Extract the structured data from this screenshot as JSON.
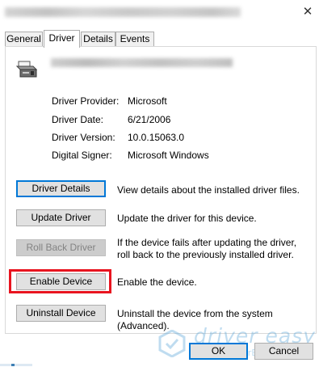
{
  "window": {
    "title_redacted": true,
    "close_glyph": "✕"
  },
  "tabs": [
    {
      "label": "General",
      "active": false
    },
    {
      "label": "Driver",
      "active": true
    },
    {
      "label": "Details",
      "active": false
    },
    {
      "label": "Events",
      "active": false
    }
  ],
  "device": {
    "icon": "printer-icon",
    "name_redacted": true
  },
  "properties": {
    "provider_label": "Driver Provider:",
    "provider_value": "Microsoft",
    "date_label": "Driver Date:",
    "date_value": "6/21/2006",
    "version_label": "Driver Version:",
    "version_value": "10.0.15063.0",
    "signer_label": "Digital Signer:",
    "signer_value": "Microsoft Windows"
  },
  "actions": {
    "driver_details": {
      "label": "Driver Details",
      "description": "View details about the installed driver files."
    },
    "update_driver": {
      "label": "Update Driver",
      "description": "Update the driver for this device."
    },
    "roll_back": {
      "label": "Roll Back Driver",
      "description": "If the device fails after updating the driver, roll back to the previously installed driver."
    },
    "enable_device": {
      "label": "Enable Device",
      "description": "Enable the device."
    },
    "uninstall_device": {
      "label": "Uninstall Device",
      "description": "Uninstall the device from the system (Advanced)."
    }
  },
  "footer": {
    "ok_label": "OK",
    "cancel_label": "Cancel"
  },
  "watermark": {
    "name": "driver easy",
    "url": "www.DriverEasy.com"
  },
  "colors": {
    "highlight": "#e8141f",
    "focus_border": "#0078d7",
    "watermark": "#5aa6d8"
  }
}
